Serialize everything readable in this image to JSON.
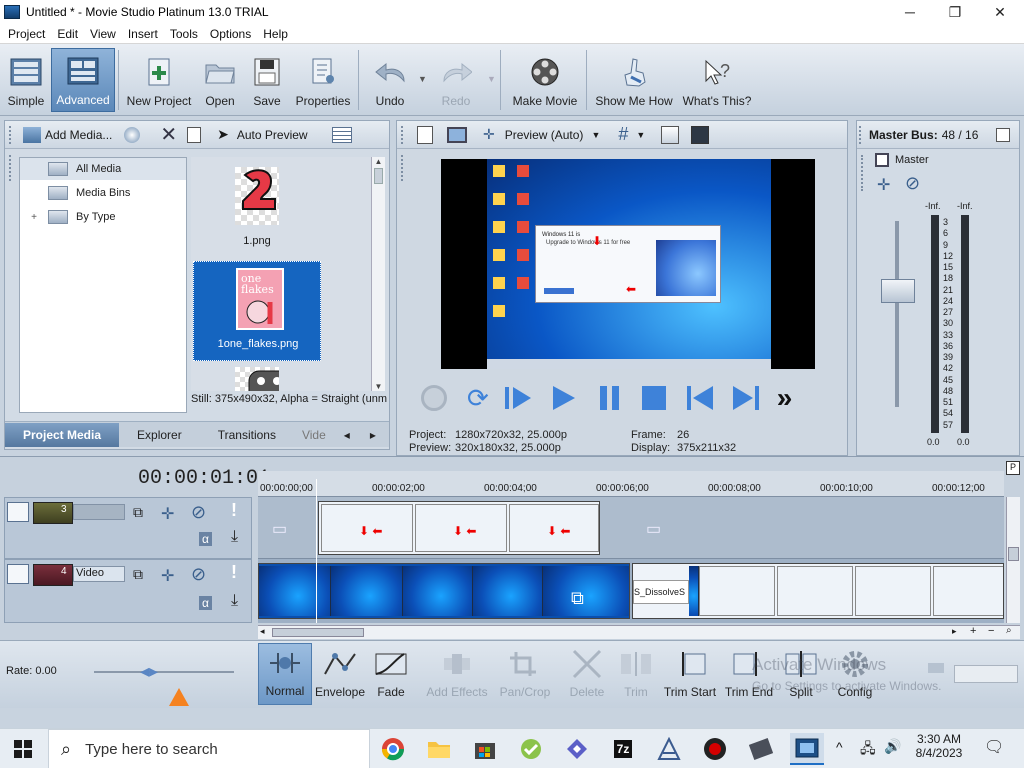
{
  "window": {
    "title": "Untitled * - Movie Studio Platinum 13.0 TRIAL",
    "minimize_label": "─",
    "maximize_label": "❐",
    "close_label": "✕"
  },
  "menu": [
    "Project",
    "Edit",
    "View",
    "Insert",
    "Tools",
    "Options",
    "Help"
  ],
  "toolbar": {
    "simple": "Simple",
    "advanced": "Advanced",
    "new_project": "New Project",
    "open": "Open",
    "save": "Save",
    "properties": "Properties",
    "undo": "Undo",
    "redo": "Redo",
    "make_movie": "Make Movie",
    "show_me_how": "Show Me How",
    "whats_this": "What's This?"
  },
  "media_panel": {
    "add_media": "Add Media...",
    "auto_preview": "Auto Preview",
    "tree": [
      "All Media",
      "Media Bins",
      "By Type"
    ],
    "files": [
      "1.png",
      "1one_flakes.png"
    ],
    "thumb_text": "one flakes",
    "status": "Still: 375x490x32, Alpha = Straight (unm",
    "tabs": [
      "Project Media",
      "Explorer",
      "Transitions",
      "Vide"
    ]
  },
  "preview": {
    "label": "Preview (Auto)",
    "project_label": "Project:",
    "project_value": "1280x720x32, 25.000p",
    "preview_label": "Preview:",
    "preview_value": "320x180x32, 25.000p",
    "frame_label": "Frame:",
    "frame_value": "26",
    "display_label": "Display:",
    "display_value": "375x211x32"
  },
  "master": {
    "title": "Master Bus:",
    "value": "48 / 16",
    "label": "Master",
    "inf_left": "-Inf.",
    "inf_right": "-Inf.",
    "scale": [
      "3",
      "6",
      "9",
      "12",
      "15",
      "18",
      "21",
      "24",
      "27",
      "30",
      "33",
      "36",
      "39",
      "42",
      "45",
      "48",
      "51",
      "54",
      "57"
    ],
    "bottom_left": "0.0",
    "bottom_right": "0.0"
  },
  "timeline": {
    "timecode": "00:00:01:01",
    "ruler": [
      "00:00:00;00",
      "00:00:02;00",
      "00:00:04;00",
      "00:00:06;00",
      "00:00:08;00",
      "00:00:10;00",
      "00:00:12;00"
    ],
    "track3_num": "3",
    "track4_num": "4",
    "track4_name": "Video",
    "transition_text": "S_DissolveS",
    "rate": "Rate: 0.00"
  },
  "edit_toolbar": {
    "normal": "Normal",
    "envelope": "Envelope",
    "fade": "Fade",
    "add_effects": "Add Effects",
    "pan_crop": "Pan/Crop",
    "delete": "Delete",
    "trim": "Trim",
    "trim_start": "Trim Start",
    "trim_end": "Trim End",
    "split": "Split",
    "config": "Config"
  },
  "watermark": {
    "line1": "Activate Windows",
    "line2": "Go to Settings to activate Windows."
  },
  "screen_dialog": {
    "title": "Windows 11 is",
    "heading": "Upgrade to Windows 11 for free"
  },
  "taskbar": {
    "search_placeholder": "Type here to search",
    "time": "3:30 AM",
    "date": "8/4/2023",
    "app_7z": "7z"
  },
  "colors": {
    "accent": "#5b88b9",
    "selection": "#1565c0",
    "playhead": "#ffffff",
    "record": "#d40000"
  }
}
